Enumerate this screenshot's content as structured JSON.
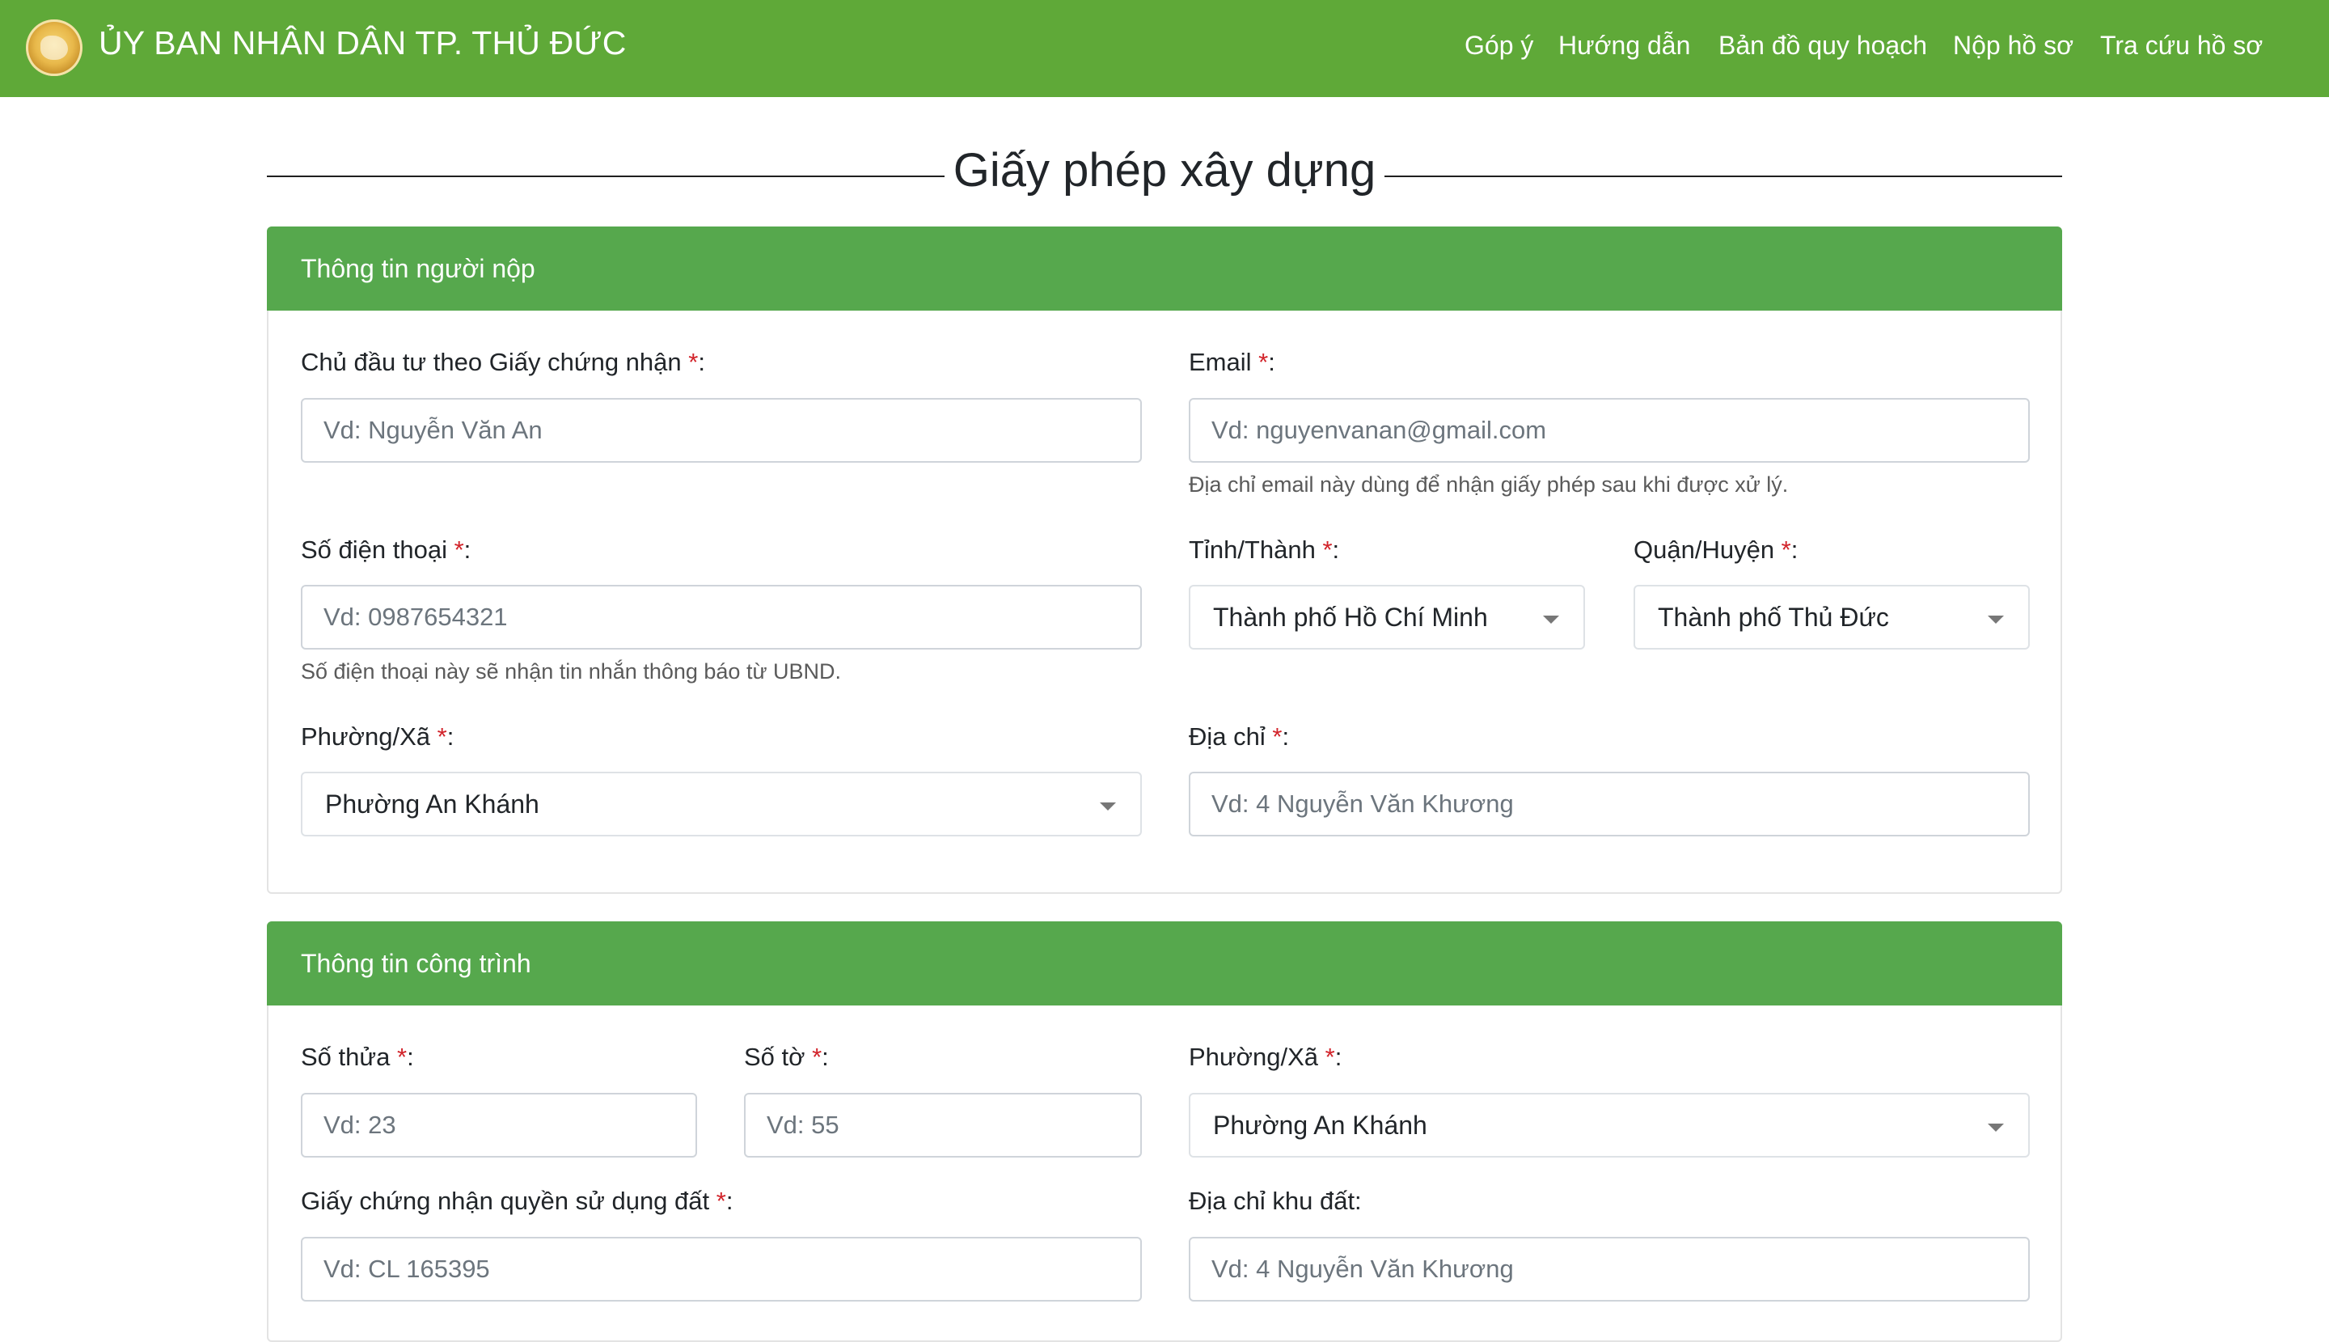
{
  "header": {
    "brand": "ỦY BAN NHÂN DÂN TP. THỦ ĐỨC",
    "nav": [
      "Góp ý",
      "Hướng dẫn",
      "Bản đồ quy hoạch",
      "Nộp hồ sơ",
      "Tra cứu hồ sơ"
    ]
  },
  "page_title": "Giấy phép xây dựng",
  "applicant": {
    "heading": "Thông tin người nộp",
    "owner": {
      "label": "Chủ đầu tư theo Giấy chứng nhận ",
      "placeholder": "Vd: Nguyễn Văn An"
    },
    "email": {
      "label": "Email ",
      "placeholder": "Vd: nguyenvanan@gmail.com",
      "help": "Địa chỉ email này dùng để nhận giấy phép sau khi được xử lý."
    },
    "phone": {
      "label": "Số điện thoại ",
      "placeholder": "Vd: 0987654321",
      "help": "Số điện thoại này sẽ nhận tin nhắn thông báo từ UBND."
    },
    "province": {
      "label": "Tỉnh/Thành ",
      "value": "Thành phố Hồ Chí Minh"
    },
    "district": {
      "label": "Quận/Huyện ",
      "value": "Thành phố Thủ Đức"
    },
    "ward": {
      "label": "Phường/Xã ",
      "value": "Phường An Khánh"
    },
    "address": {
      "label": "Địa chỉ ",
      "placeholder": "Vd: 4 Nguyễn Văn Khương"
    }
  },
  "project": {
    "heading": "Thông tin công trình",
    "plot": {
      "label": "Số thửa ",
      "placeholder": "Vd: 23"
    },
    "sheet": {
      "label": "Số tờ ",
      "placeholder": "Vd: 55"
    },
    "ward": {
      "label": "Phường/Xã ",
      "value": "Phường An Khánh"
    },
    "certificate": {
      "label": "Giấy chứng nhận quyền sử dụng đất ",
      "placeholder": "Vd: CL 165395"
    },
    "land_address": {
      "label": "Địa chỉ khu đất:",
      "placeholder": "Vd: 4 Nguyễn Văn Khương"
    }
  },
  "required_mark": "*",
  "colon": ":",
  "colors": {
    "header_green": "#5fa938",
    "card_green": "#56a84d",
    "required_red": "#d2232a"
  },
  "icons": {
    "logo": "emblem-logo",
    "dropdown": "caret-down-icon"
  }
}
